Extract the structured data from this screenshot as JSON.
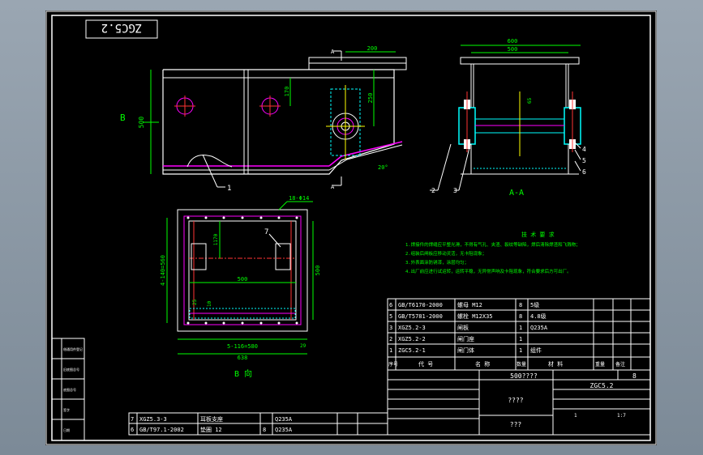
{
  "colors": {
    "frame": "#ffffff",
    "dimension": "#00ff00",
    "part": "#ffffff",
    "accent": "#ff00ff",
    "section": "#00ffff",
    "center": "#ff3333",
    "axis": "#ffff00",
    "leader": "#00ff00"
  },
  "title_tag": "ZGC5.2",
  "labels": {
    "b_arrow": "B",
    "a_top": "A",
    "a_bottom": "A",
    "section_aa": "A-A",
    "view_b": "B 向"
  },
  "dims": {
    "top_200": "200",
    "height_500": "500",
    "v_170": "170",
    "v_250": "250",
    "angle": "20°",
    "w600": "600",
    "w500": "500",
    "h65": "65",
    "holes": "18-Φ14",
    "h1170": "1170",
    "h4140": "4-140=560",
    "h500b": "500",
    "v500": "500",
    "b25": "25",
    "b10": "10",
    "bottom5116": "5-116=580",
    "bottom638": "638",
    "side29": "29"
  },
  "part_callouts": [
    "1",
    "2",
    "3",
    "4",
    "5",
    "6",
    "7"
  ],
  "notes": {
    "title": "技 术 要 求",
    "lines": [
      "1.焊接件的焊缝应平整光滑，不得有气孔、夹渣、裂纹等缺陷，焊后清除焊渣和飞溅物；",
      "2.组装后闸板应移动灵活，无卡阻现象；",
      "3.外表面涂防锈漆，涂层均匀；",
      "4.出厂前应进行试运转，运转平稳，无异常声响及卡阻现象，符合要求后方可出厂。"
    ]
  },
  "bom_upper": [
    {
      "no": "6",
      "code": "GB/T6170-2000",
      "name": "螺母 M12",
      "qty": "8",
      "mat": "5级"
    },
    {
      "no": "5",
      "code": "GB/T5781-2000",
      "name": "螺栓 M12X35",
      "qty": "8",
      "mat": "4.8级"
    },
    {
      "no": "3",
      "code": "XGZ5.2-3",
      "name": "闸板",
      "qty": "1",
      "mat": "Q235A"
    },
    {
      "no": "2",
      "code": "XGZ5.2-2",
      "name": "闸门座",
      "qty": "1",
      "mat": ""
    },
    {
      "no": "1",
      "code": "ZGC5.2-1",
      "name": "闸门体",
      "qty": "1",
      "mat": "组件"
    }
  ],
  "bom_header": {
    "no": "序号",
    "code": "代 号",
    "name": "名 称",
    "qty": "数量",
    "mat": "材 料",
    "weight": "重量",
    "remark": "备注"
  },
  "title_block": {
    "name": "500????",
    "code": "ZGC5.2",
    "qty": "8",
    "unit": "????",
    "company": "???",
    "scale": "1:7",
    "sheet": "1"
  },
  "bom_lower": [
    {
      "no": "7",
      "code": "XGZ5.3-3",
      "name": "耳板支座",
      "qty": "",
      "mat": "Q235A"
    },
    {
      "no": "6",
      "code": "GB/T97.1-2002",
      "name": "垫圈 12",
      "qty": "8",
      "mat": "Q235A"
    }
  ],
  "left_strip": [
    "借通用件登记",
    "旧底图总号",
    "底图总号",
    "签字",
    "日期"
  ]
}
